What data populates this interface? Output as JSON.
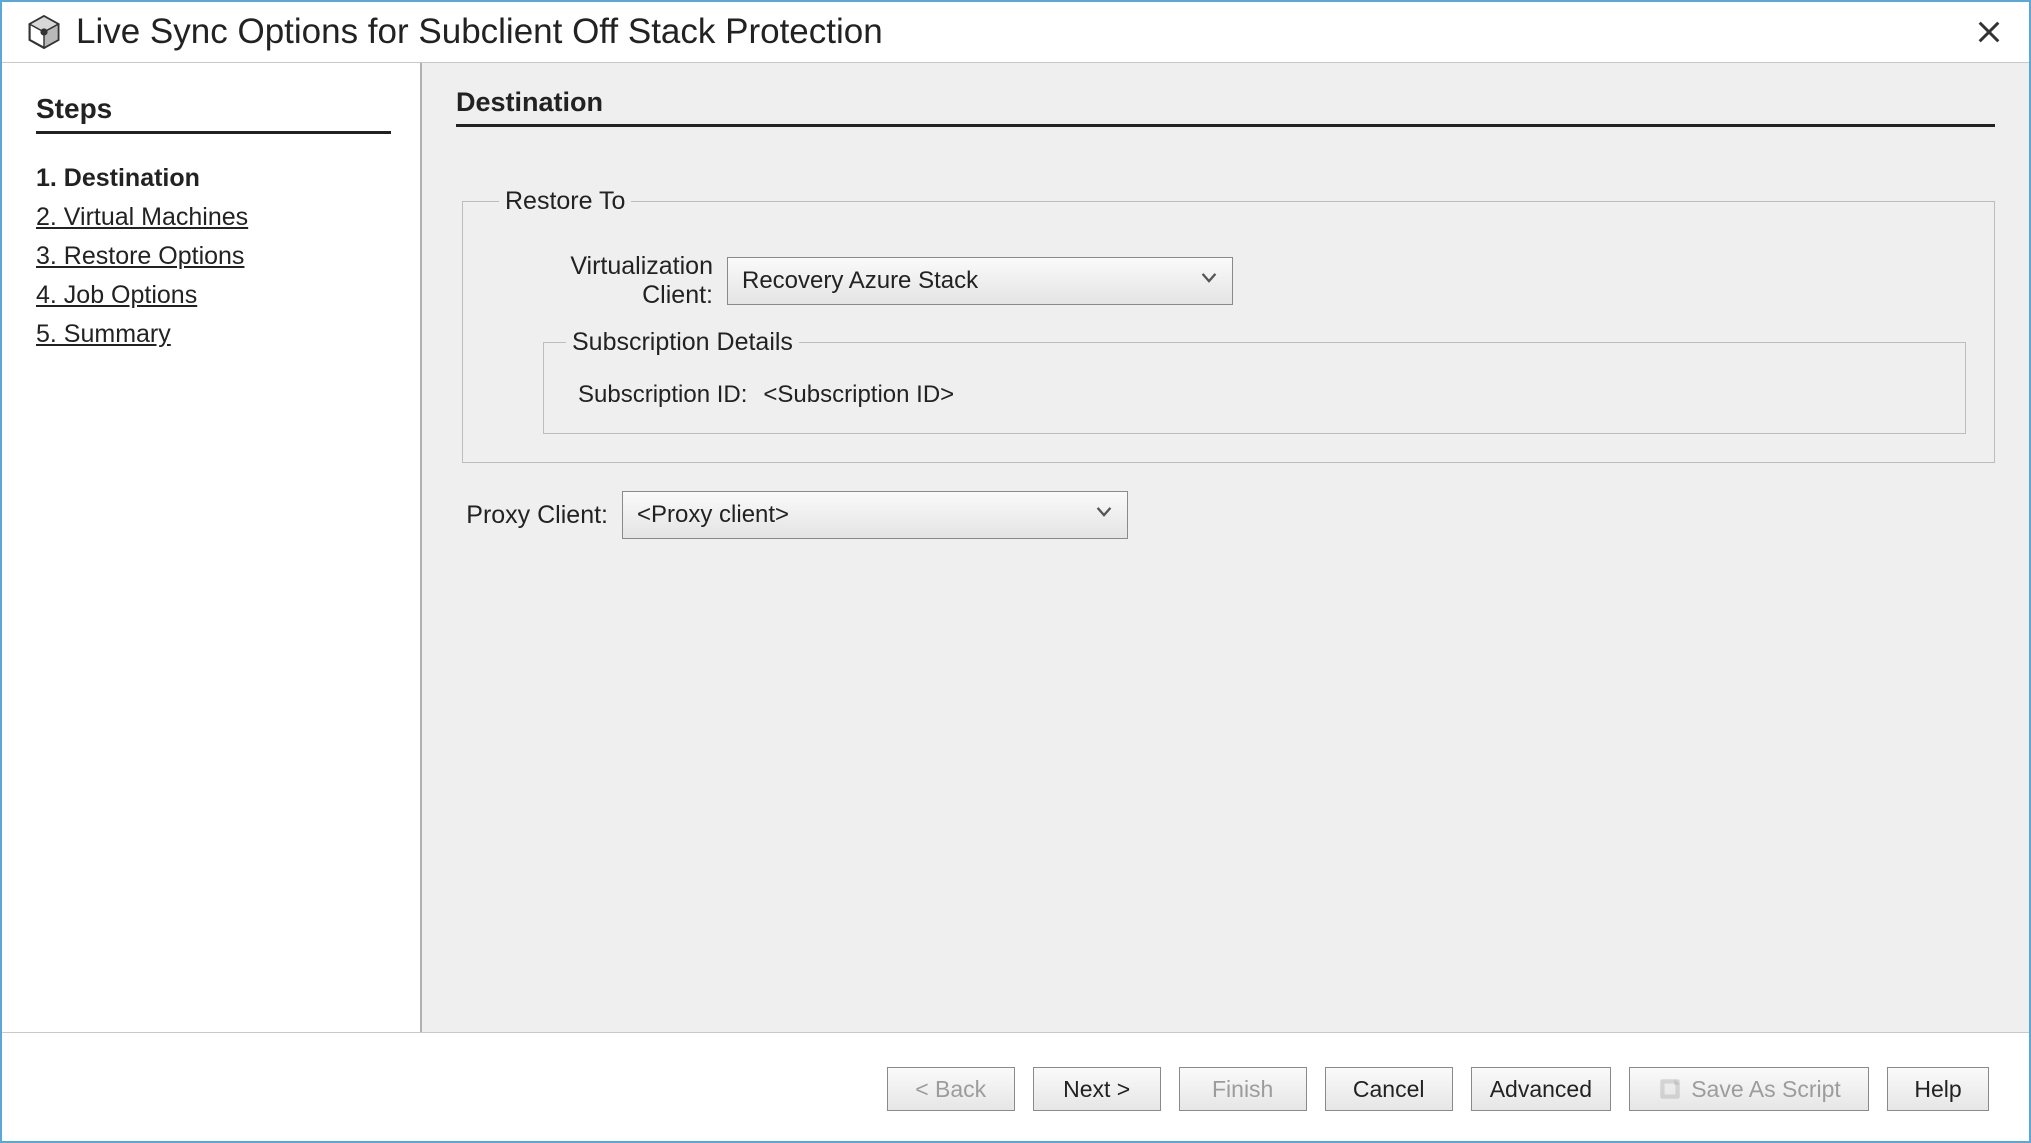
{
  "window": {
    "title": "Live Sync Options for Subclient Off Stack Protection"
  },
  "sidebar": {
    "heading": "Steps",
    "items": [
      {
        "label": "1. Destination",
        "active": true
      },
      {
        "label": "2. Virtual Machines",
        "active": false
      },
      {
        "label": "3. Restore Options",
        "active": false
      },
      {
        "label": "4. Job Options",
        "active": false
      },
      {
        "label": "5. Summary",
        "active": false
      }
    ]
  },
  "main": {
    "heading": "Destination",
    "restore_to_legend": "Restore To",
    "virtualization_client_label": "Virtualization Client:",
    "virtualization_client_value": "Recovery Azure Stack",
    "subscription_details_legend": "Subscription Details",
    "subscription_id_label": "Subscription ID:",
    "subscription_id_value": "<Subscription ID>",
    "proxy_client_label": "Proxy Client:",
    "proxy_client_value": "<Proxy client>"
  },
  "footer": {
    "back": "< Back",
    "next": "Next >",
    "finish": "Finish",
    "cancel": "Cancel",
    "advanced": "Advanced",
    "save_script": "Save As Script",
    "help": "Help"
  }
}
